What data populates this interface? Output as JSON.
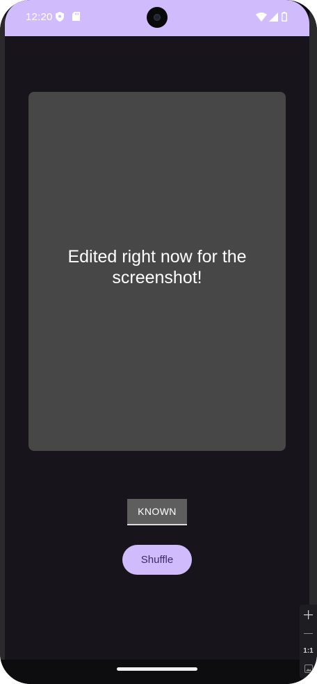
{
  "status_bar": {
    "time": "12:20",
    "left_icons": [
      "shield-icon",
      "sd-card-icon"
    ],
    "right_icons": [
      "wifi-icon",
      "cellular-signal-icon",
      "battery-icon"
    ],
    "color": "#d0bcfc"
  },
  "card": {
    "text": "Edited right now for the screenshot!",
    "background": "#474747"
  },
  "buttons": {
    "known_label": "KNOWN",
    "shuffle_label": "Shuffle"
  },
  "side_toolbar": {
    "zoom_in_icon": "plus-icon",
    "zoom_out_icon": "minus-icon",
    "actual_size_label": "1:1",
    "screenshot_icon": "image-icon"
  },
  "colors": {
    "accent": "#d0bcfc",
    "background": "#17151b"
  }
}
